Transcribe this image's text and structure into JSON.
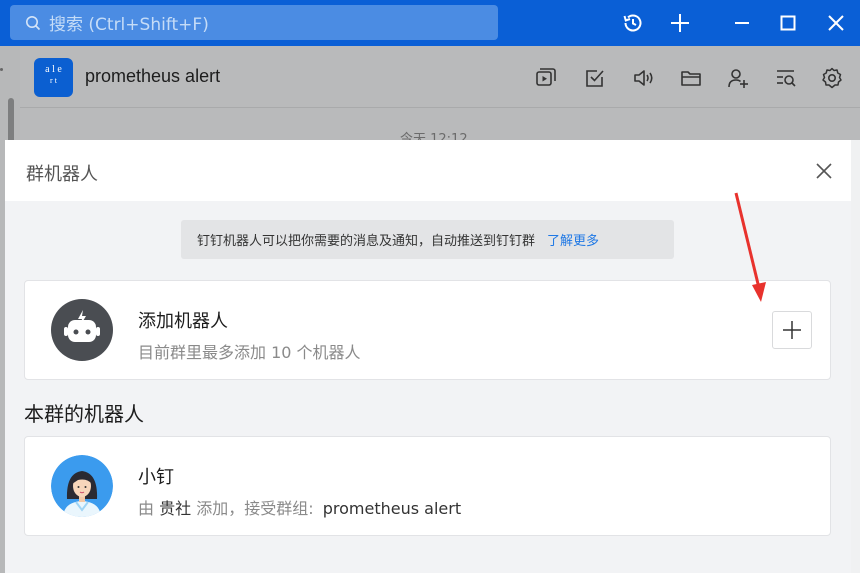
{
  "titlebar": {
    "search_placeholder": "搜索 (Ctrl+Shift+F)"
  },
  "chat": {
    "logo_text_top": "a l e",
    "logo_text_bottom": "r t",
    "title": "prometheus alert",
    "time": "今天 12:12"
  },
  "dialog": {
    "title": "群机器人",
    "notice_text": "钉钉机器人可以把你需要的消息及通知，自动推送到钉钉群",
    "notice_link": "了解更多",
    "add_card": {
      "title": "添加机器人",
      "subtitle": "目前群里最多添加 10 个机器人"
    },
    "section_title": "本群的机器人",
    "robot": {
      "name": "小钉",
      "added_prefix": "由",
      "added_by": "贵社",
      "added_middle": "添加，接受群组:",
      "group": "prometheus alert"
    }
  },
  "colors": {
    "titlebar": "#0a5fd6",
    "accent_link": "#1f78e5",
    "annotation_arrow": "#e8322d"
  },
  "icons": [
    "search-icon",
    "history-icon",
    "plus-icon",
    "minimize-icon",
    "maximize-icon",
    "close-icon",
    "video-icon",
    "task-icon",
    "speaker-icon",
    "folder-icon",
    "add-member-icon",
    "chat-search-icon",
    "settings-icon"
  ]
}
